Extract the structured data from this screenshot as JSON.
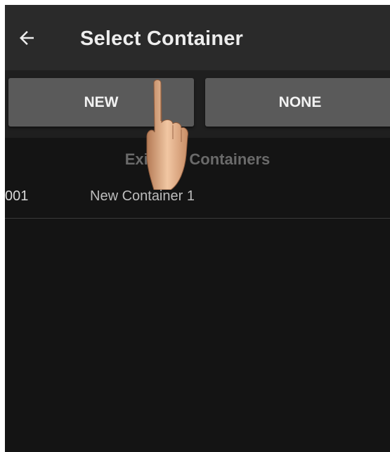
{
  "appbar": {
    "title": "Select Container",
    "back_icon": "arrow-left-icon"
  },
  "buttons": {
    "new_label": "NEW",
    "none_label": "NONE"
  },
  "list": {
    "header": "Existing Containers",
    "items": [
      {
        "id": "001",
        "name": "New Container 1"
      }
    ]
  },
  "overlay": {
    "icon": "pointing-hand-icon"
  },
  "colors": {
    "background": "#141414",
    "appbar": "#2a2a2a",
    "button": "#5a5a5a",
    "header_text": "#6a6a6a"
  }
}
